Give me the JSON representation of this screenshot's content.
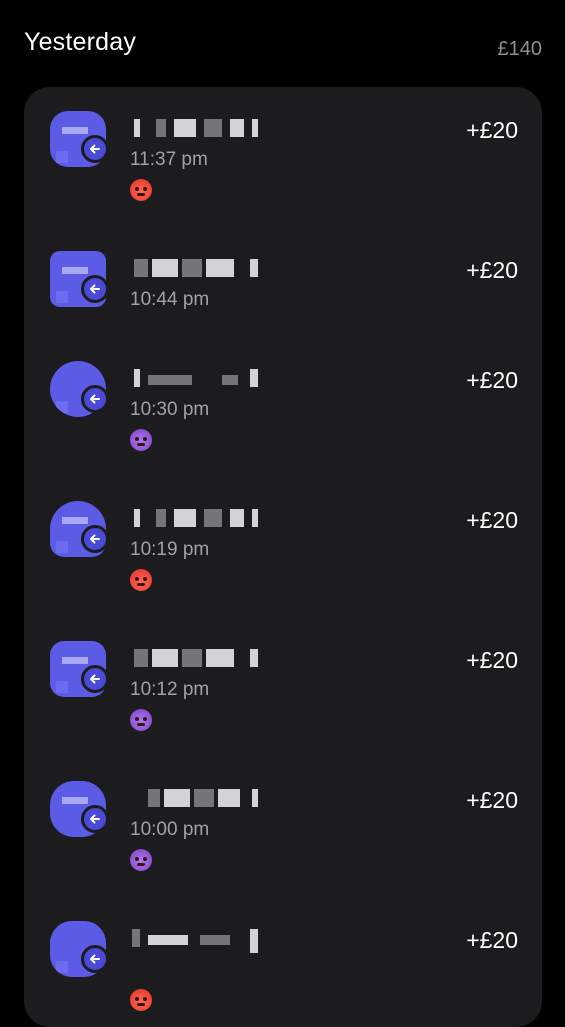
{
  "header": {
    "title": "Yesterday",
    "total": "£140"
  },
  "transactions": [
    {
      "time": "11:37 pm",
      "amount": "+£20",
      "emoji": "hot-face-icon"
    },
    {
      "time": "10:44 pm",
      "amount": "+£20",
      "emoji": ""
    },
    {
      "time": "10:30 pm",
      "amount": "+£20",
      "emoji": "smiling-devil-icon"
    },
    {
      "time": "10:19 pm",
      "amount": "+£20",
      "emoji": "hot-face-icon"
    },
    {
      "time": "10:12 pm",
      "amount": "+£20",
      "emoji": "smiling-devil-icon"
    },
    {
      "time": "10:00 pm",
      "amount": "+£20",
      "emoji": "smiling-devil-icon"
    },
    {
      "time": "",
      "amount": "+£20",
      "emoji": "hot-face-icon"
    }
  ],
  "colors": {
    "background": "#000000",
    "card": "#1c1c1e",
    "avatar": "#5b5be6",
    "secondary_text": "#a1a1a6"
  }
}
